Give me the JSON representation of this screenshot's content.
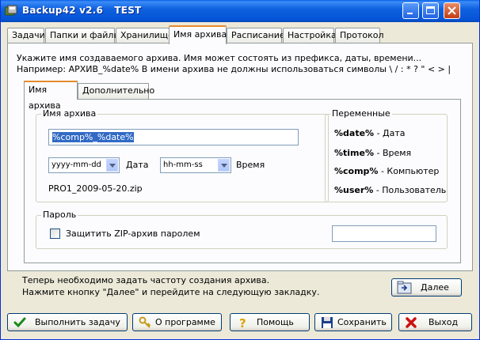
{
  "window": {
    "app_name": "Backup42 v2.6",
    "profile": "TEST"
  },
  "tabs": [
    {
      "label": "Задачи"
    },
    {
      "label": "Папки и файлы"
    },
    {
      "label": "Хранилище"
    },
    {
      "label": "Имя архива",
      "active": true
    },
    {
      "label": "Расписание"
    },
    {
      "label": "Настройка"
    },
    {
      "label": "Протокол"
    }
  ],
  "info": {
    "line1": "Укажите имя создаваемого архива. Имя может состоять из префикса, даты, времени...",
    "line2": "Например: АРХИВ_%date% В имени архива не должны использоваться символы \\ / : * ? \" < > |"
  },
  "inner_tabs": [
    {
      "label": "Имя архива",
      "active": true
    },
    {
      "label": "Дополнительно"
    }
  ],
  "archive_name": {
    "group_label": "Имя архива",
    "input_value": "%comp%_%date%",
    "date_format": "yyyy-mm-dd",
    "date_label": "Дата",
    "time_format": "hh-mm-ss",
    "time_label": "Время",
    "preview": "PRO1_2009-05-20.zip"
  },
  "variables": {
    "group_label": "Переменные",
    "items": [
      {
        "name": "%date%",
        "desc": "- Дата"
      },
      {
        "name": "%time%",
        "desc": "- Время"
      },
      {
        "name": "%comp%",
        "desc": "- Компьютер"
      },
      {
        "name": "%user%",
        "desc": "- Пользователь"
      }
    ]
  },
  "password": {
    "group_label": "Пароль",
    "checkbox_label": "Защитить ZIP-архив паролем",
    "checked": false,
    "value": ""
  },
  "bottom": {
    "line1": "Теперь необходимо задать частоту создания архива.",
    "line2": "Нажмите кнопку \"Далее\" и перейдите на следующую закладку.",
    "next_label": "Далее"
  },
  "buttons": {
    "run": "Выполнить задачу",
    "about": "О программе",
    "help": "Помощь",
    "save": "Сохранить",
    "exit": "Выход"
  },
  "colors": {
    "titlebar": "#0554d6",
    "selection": "#316ac5",
    "active_tab_accent": "#e68b2c"
  }
}
